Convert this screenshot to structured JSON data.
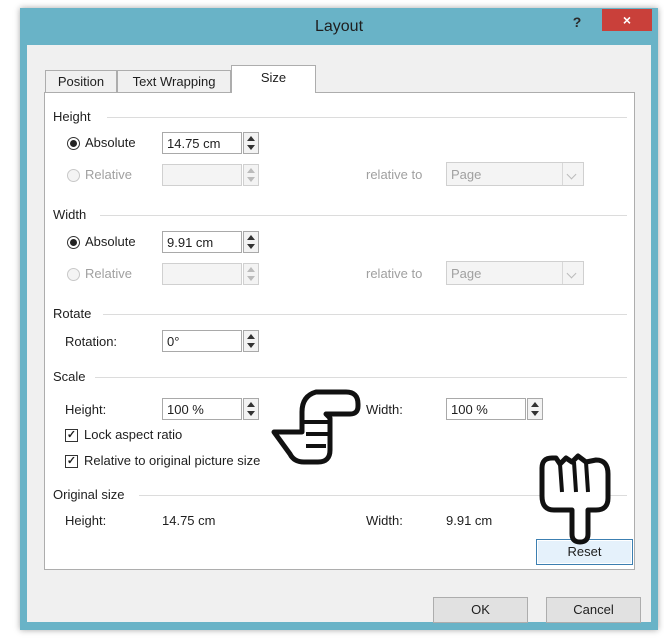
{
  "window": {
    "title": "Layout",
    "help_label": "?",
    "close_label": "×"
  },
  "tabs": [
    {
      "label": "Position",
      "active": false
    },
    {
      "label": "Text Wrapping",
      "active": false
    },
    {
      "label": "Size",
      "active": true
    }
  ],
  "height_section": {
    "title": "Height",
    "absolute_label": "Absolute",
    "absolute_value": "14.75 cm",
    "relative_label": "Relative",
    "relative_value": "",
    "relative_to_label": "relative to",
    "relative_to_value": "Page"
  },
  "width_section": {
    "title": "Width",
    "absolute_label": "Absolute",
    "absolute_value": "9.91 cm",
    "relative_label": "Relative",
    "relative_value": "",
    "relative_to_label": "relative to",
    "relative_to_value": "Page"
  },
  "rotate_section": {
    "title": "Rotate",
    "rotation_label": "Rotation:",
    "rotation_value": "0°"
  },
  "scale_section": {
    "title": "Scale",
    "height_label": "Height:",
    "height_value": "100 %",
    "width_label": "Width:",
    "width_value": "100 %",
    "lock_aspect_label": "Lock aspect ratio",
    "lock_aspect_checked": true,
    "relative_original_label": "Relative to original picture size",
    "relative_original_checked": true
  },
  "original_size_section": {
    "title": "Original size",
    "height_label": "Height:",
    "height_value": "14.75 cm",
    "width_label": "Width:",
    "width_value": "9.91 cm",
    "reset_label": "Reset"
  },
  "footer": {
    "ok_label": "OK",
    "cancel_label": "Cancel"
  },
  "colors": {
    "frame": "#69b3c7",
    "close": "#c9403a",
    "client": "#f0f0f0"
  },
  "icons": {
    "pointer_right": "hand-pointing-right-icon",
    "pointer_down": "hand-pointing-down-icon"
  }
}
